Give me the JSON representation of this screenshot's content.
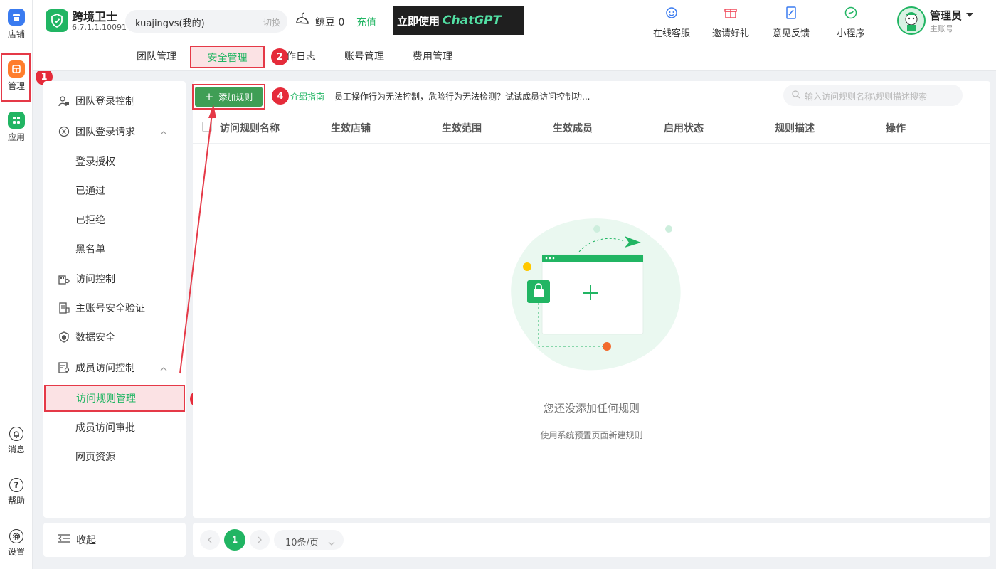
{
  "rail": {
    "items": [
      {
        "label": "店铺",
        "icon": "store-icon"
      },
      {
        "label": "管理",
        "icon": "manage-icon"
      },
      {
        "label": "应用",
        "icon": "apps-icon"
      },
      {
        "label": "消息",
        "icon": "bell-icon"
      },
      {
        "label": "帮助",
        "icon": "help-icon"
      },
      {
        "label": "设置",
        "icon": "gear-icon"
      }
    ]
  },
  "header": {
    "app_name": "跨境卫士",
    "version": "6.7.1.1.10091",
    "account": "kuajingvs(我的)",
    "switch_label": "切换",
    "coin_label": "鲸豆 0",
    "recharge_label": "充值",
    "banner_text_1": "立即使用",
    "banner_text_2": "ChatGPT",
    "actions": [
      {
        "label": "在线客服",
        "icon": "customer-service-icon"
      },
      {
        "label": "邀请好礼",
        "icon": "gift-icon"
      },
      {
        "label": "意见反馈",
        "icon": "feedback-icon"
      },
      {
        "label": "小程序",
        "icon": "mini-program-icon"
      }
    ],
    "user_name": "管理员",
    "user_role": "主账号"
  },
  "tabs": [
    "团队管理",
    "安全管理",
    "作日志",
    "账号管理",
    "费用管理"
  ],
  "menu": {
    "items": [
      {
        "label": "团队登录控制"
      },
      {
        "label": "团队登录请求"
      },
      {
        "label": "登录授权"
      },
      {
        "label": "已通过"
      },
      {
        "label": "已拒绝"
      },
      {
        "label": "黑名单"
      },
      {
        "label": "访问控制"
      },
      {
        "label": "主账号安全验证"
      },
      {
        "label": "数据安全"
      },
      {
        "label": "成员访问控制"
      },
      {
        "label": "访问规则管理"
      },
      {
        "label": "成员访问审批"
      },
      {
        "label": "网页资源"
      }
    ],
    "collapse_label": "收起"
  },
  "toolbar": {
    "add_rule_label": "添加规则",
    "guide_link": "介绍指南",
    "guide_text": "员工操作行为无法控制，危险行为无法检测？试试成员访问控制功...",
    "search_placeholder": "输入访问规则名称\\规则描述搜索"
  },
  "table": {
    "columns": [
      "访问规则名称",
      "生效店铺",
      "生效范围",
      "生效成员",
      "启用状态",
      "规则描述",
      "操作"
    ]
  },
  "empty": {
    "title": "您还没添加任何规则",
    "subtitle": "使用系统预置页面新建规则"
  },
  "pager": {
    "current_page": "1",
    "page_size": "10条/页"
  },
  "annotations": [
    "1",
    "2",
    "3",
    "4"
  ],
  "colors": {
    "brand_green": "#21b563",
    "button_green": "#3f9e55",
    "annotation_red": "#e53947",
    "active_menu_bg": "#fbe2e4"
  }
}
